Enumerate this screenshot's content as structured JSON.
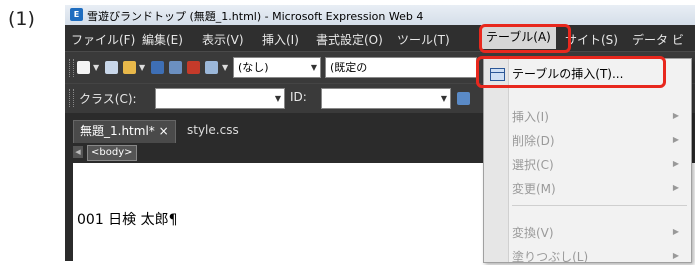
{
  "step_label": "(1)",
  "window": {
    "title": "雪遊びランドトップ (無題_1.html) - Microsoft Expression Web 4",
    "app_icon_letter": "E"
  },
  "menubar": [
    {
      "label": "ファイル(F)"
    },
    {
      "label": "編集(E)"
    },
    {
      "label": "表示(V)"
    },
    {
      "label": "挿入(I)"
    },
    {
      "label": "書式設定(O)"
    },
    {
      "label": "ツール(T)"
    },
    {
      "label": "テーブル(A)"
    },
    {
      "label": "サイト(S)"
    },
    {
      "label": "データ ビ"
    }
  ],
  "toolbar": {
    "style_combo": "(なし)",
    "font_combo": "(既定の"
  },
  "toolbar2": {
    "class_label": "クラス(C):",
    "id_label": "ID:"
  },
  "tabs": [
    {
      "label": "無題_1.html* ×"
    },
    {
      "label": "style.css"
    }
  ],
  "breadcrumb": {
    "tag": "<body>"
  },
  "editor": {
    "text": "001 日検 太郎¶"
  },
  "dropdown": {
    "items": [
      {
        "label": "テーブルの挿入(T)..."
      },
      {
        "label": "挿入(I)"
      },
      {
        "label": "削除(D)"
      },
      {
        "label": "選択(C)"
      },
      {
        "label": "変更(M)"
      },
      {
        "label": "変換(V)"
      },
      {
        "label": "塗りつぶし(L)"
      }
    ]
  },
  "colors": {
    "highlight": "#e8281e",
    "menubar_bg": "#2f2f2f",
    "toolbar_bg": "#3a3a3a"
  }
}
